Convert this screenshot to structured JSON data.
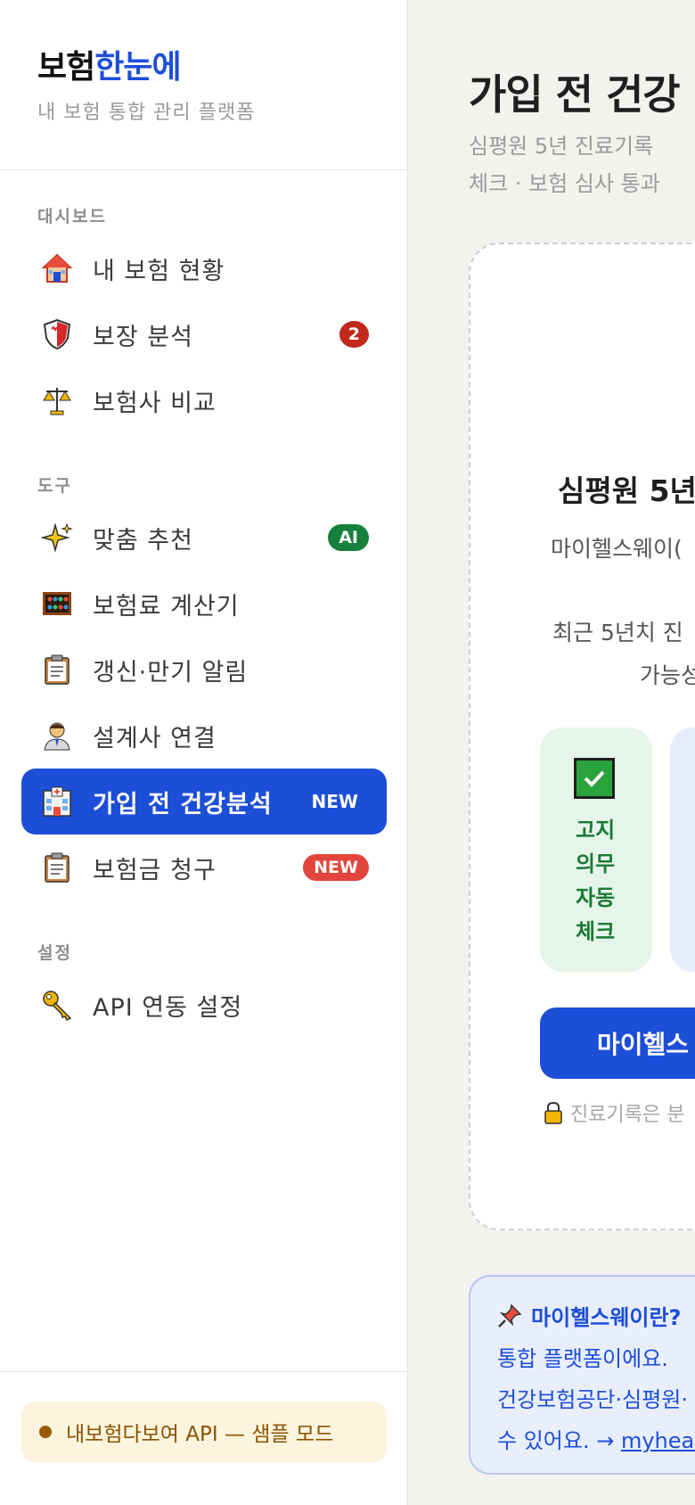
{
  "brand": {
    "name_a": "보험",
    "name_b": "한눈에",
    "subtitle": "내 보험 통합 관리 플랫폼"
  },
  "sidebar": {
    "sections": [
      {
        "label": "대시보드"
      },
      {
        "label": "도구"
      },
      {
        "label": "설정"
      }
    ],
    "items": [
      {
        "label": "내 보험 현황",
        "icon": "house-icon"
      },
      {
        "label": "보장 분석",
        "icon": "shield-icon",
        "badge": "2"
      },
      {
        "label": "보험사 비교",
        "icon": "scales-icon"
      },
      {
        "label": "맞춤 추천",
        "icon": "sparkles-icon",
        "badge": "AI"
      },
      {
        "label": "보험료 계산기",
        "icon": "abacus-icon"
      },
      {
        "label": "갱신·만기 알림",
        "icon": "clipboard-icon"
      },
      {
        "label": "설계사 연결",
        "icon": "person-icon"
      },
      {
        "label": "가입 전 건강분석",
        "icon": "hospital-icon",
        "badge": "NEW",
        "active": true
      },
      {
        "label": "보험금 청구",
        "icon": "clipboard-icon",
        "badge": "NEW"
      },
      {
        "label": "API 연동 설정",
        "icon": "key-icon"
      }
    ],
    "api_banner": "내보험다보여 API — 샘플 모드"
  },
  "main": {
    "title": "가입 전 건강",
    "subtitle_lines": [
      "심평원 5년 진료기록 ",
      "체크 · 보험 심사 통과"
    ],
    "card": {
      "title": "심평원 5년",
      "lines": [
        "마이헬스웨이(",
        "최근 5년치 진",
        "가능성"
      ],
      "feature_green": "고지 의무 자동 체크",
      "cta": "마이헬스",
      "privacy": "진료기록은 분"
    },
    "info": {
      "title": "마이헬스웨이란?",
      "lines": [
        "통합 플랫폼이에요.",
        "건강보험공단·심평원·",
        "수 있어요. → "
      ],
      "link": "myheal"
    }
  },
  "colors": {
    "accent": "#1d4ed8",
    "sidebar_bg": "#ffffff",
    "page_bg": "#f3f2ef"
  }
}
